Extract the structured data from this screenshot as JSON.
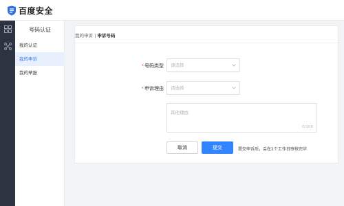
{
  "brand": {
    "name": "百度安全",
    "logo_icon": "shield-logo-icon"
  },
  "rail": {
    "items": [
      {
        "icon": "grid-icon"
      },
      {
        "icon": "share-nodes-icon"
      }
    ]
  },
  "subnav": {
    "title": "号码认证",
    "items": [
      {
        "label": "我的认证",
        "active": false
      },
      {
        "label": "我的申诉",
        "active": true
      },
      {
        "label": "我的举报",
        "active": false
      }
    ]
  },
  "breadcrumb": {
    "parent": "我的申诉",
    "separator": " | ",
    "current": "申诉号码"
  },
  "form": {
    "number_type": {
      "required_mark": "*",
      "label": "号码类型",
      "placeholder": "请选择"
    },
    "reason": {
      "required_mark": "*",
      "label": "申诉理由",
      "placeholder": "请选择"
    },
    "other_reason": {
      "placeholder": "其他理由",
      "counter": "0/100"
    },
    "cancel_label": "取消",
    "submit_label": "提交",
    "hint": "提交申诉后，会在2个工作日审核完毕"
  },
  "colors": {
    "accent": "#3385ff",
    "rail": "#2b3440",
    "required": "#f56c6c"
  }
}
